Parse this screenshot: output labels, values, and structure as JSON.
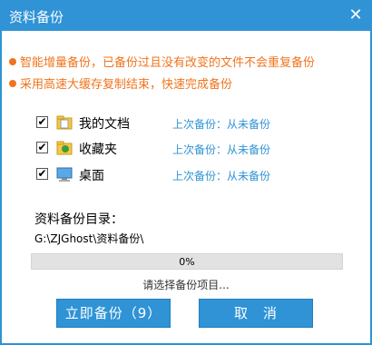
{
  "window": {
    "title": "资料备份",
    "close_glyph": "✕"
  },
  "notices": [
    "智能增量备份，已备份过且没有改变的文件不会重复备份",
    "采用高速大缓存复制结束，快速完成备份"
  ],
  "items": [
    {
      "name": "我的文档",
      "status": "上次备份：从未备份",
      "checked": true,
      "icon": "documents-folder-icon"
    },
    {
      "name": "收藏夹",
      "status": "上次备份：从未备份",
      "checked": true,
      "icon": "favorites-folder-icon"
    },
    {
      "name": "桌面",
      "status": "上次备份：从未备份",
      "checked": true,
      "icon": "desktop-icon"
    }
  ],
  "backup_dir": {
    "label": "资料备份目录：",
    "path": "G:\\ZJGhost\\资料备份\\"
  },
  "progress": {
    "text": "0%",
    "value": 0
  },
  "hint": "请选择备份项目...",
  "buttons": {
    "start": "立即备份（9）",
    "cancel": "取　消"
  },
  "colors": {
    "accent": "#2f93d6",
    "notice": "#f0741d"
  }
}
